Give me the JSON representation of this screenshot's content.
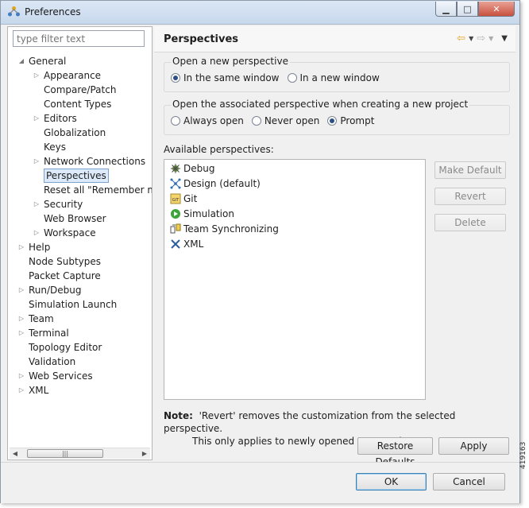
{
  "window": {
    "title": "Preferences"
  },
  "filter": {
    "placeholder": "type filter text"
  },
  "tree": [
    {
      "label": "General",
      "depth": 0,
      "toggle": "open"
    },
    {
      "label": "Appearance",
      "depth": 1,
      "toggle": "closed"
    },
    {
      "label": "Compare/Patch",
      "depth": 1,
      "toggle": "none"
    },
    {
      "label": "Content Types",
      "depth": 1,
      "toggle": "none"
    },
    {
      "label": "Editors",
      "depth": 1,
      "toggle": "closed"
    },
    {
      "label": "Globalization",
      "depth": 1,
      "toggle": "none"
    },
    {
      "label": "Keys",
      "depth": 1,
      "toggle": "none"
    },
    {
      "label": "Network Connections",
      "depth": 1,
      "toggle": "closed"
    },
    {
      "label": "Perspectives",
      "depth": 1,
      "toggle": "none",
      "selected": true
    },
    {
      "label": "Reset all \"Remember m",
      "depth": 1,
      "toggle": "none"
    },
    {
      "label": "Security",
      "depth": 1,
      "toggle": "closed"
    },
    {
      "label": "Web Browser",
      "depth": 1,
      "toggle": "none"
    },
    {
      "label": "Workspace",
      "depth": 1,
      "toggle": "closed"
    },
    {
      "label": "Help",
      "depth": 0,
      "toggle": "closed"
    },
    {
      "label": "Node Subtypes",
      "depth": 0,
      "toggle": "none"
    },
    {
      "label": "Packet Capture",
      "depth": 0,
      "toggle": "none"
    },
    {
      "label": "Run/Debug",
      "depth": 0,
      "toggle": "closed"
    },
    {
      "label": "Simulation Launch",
      "depth": 0,
      "toggle": "none"
    },
    {
      "label": "Team",
      "depth": 0,
      "toggle": "closed"
    },
    {
      "label": "Terminal",
      "depth": 0,
      "toggle": "closed"
    },
    {
      "label": "Topology Editor",
      "depth": 0,
      "toggle": "none"
    },
    {
      "label": "Validation",
      "depth": 0,
      "toggle": "none"
    },
    {
      "label": "Web Services",
      "depth": 0,
      "toggle": "closed"
    },
    {
      "label": "XML",
      "depth": 0,
      "toggle": "closed"
    }
  ],
  "page": {
    "title": "Perspectives",
    "open_group": {
      "title": "Open a new perspective",
      "options": [
        {
          "label": "In the same window",
          "checked": true
        },
        {
          "label": "In a new window",
          "checked": false
        }
      ]
    },
    "assoc_group": {
      "title": "Open the associated perspective when creating a new project",
      "options": [
        {
          "label": "Always open",
          "checked": false
        },
        {
          "label": "Never open",
          "checked": false
        },
        {
          "label": "Prompt",
          "checked": true
        }
      ]
    },
    "available_label": "Available perspectives:",
    "perspectives": [
      {
        "label": "Debug",
        "icon": "debug-icon"
      },
      {
        "label": "Design (default)",
        "icon": "design-icon"
      },
      {
        "label": "Git",
        "icon": "git-icon"
      },
      {
        "label": "Simulation",
        "icon": "simulation-icon"
      },
      {
        "label": "Team Synchronizing",
        "icon": "team-sync-icon"
      },
      {
        "label": "XML",
        "icon": "xml-icon"
      }
    ],
    "buttons": {
      "make_default": "Make Default",
      "revert": "Revert",
      "delete": "Delete"
    },
    "note_label": "Note:",
    "note_line1": "'Revert' removes the customization from the selected perspective.",
    "note_line2": "This only applies to newly opened perspectives.",
    "restore_defaults": "Restore Defaults",
    "apply": "Apply"
  },
  "dialog": {
    "ok": "OK",
    "cancel": "Cancel"
  },
  "figure_id": "419163"
}
